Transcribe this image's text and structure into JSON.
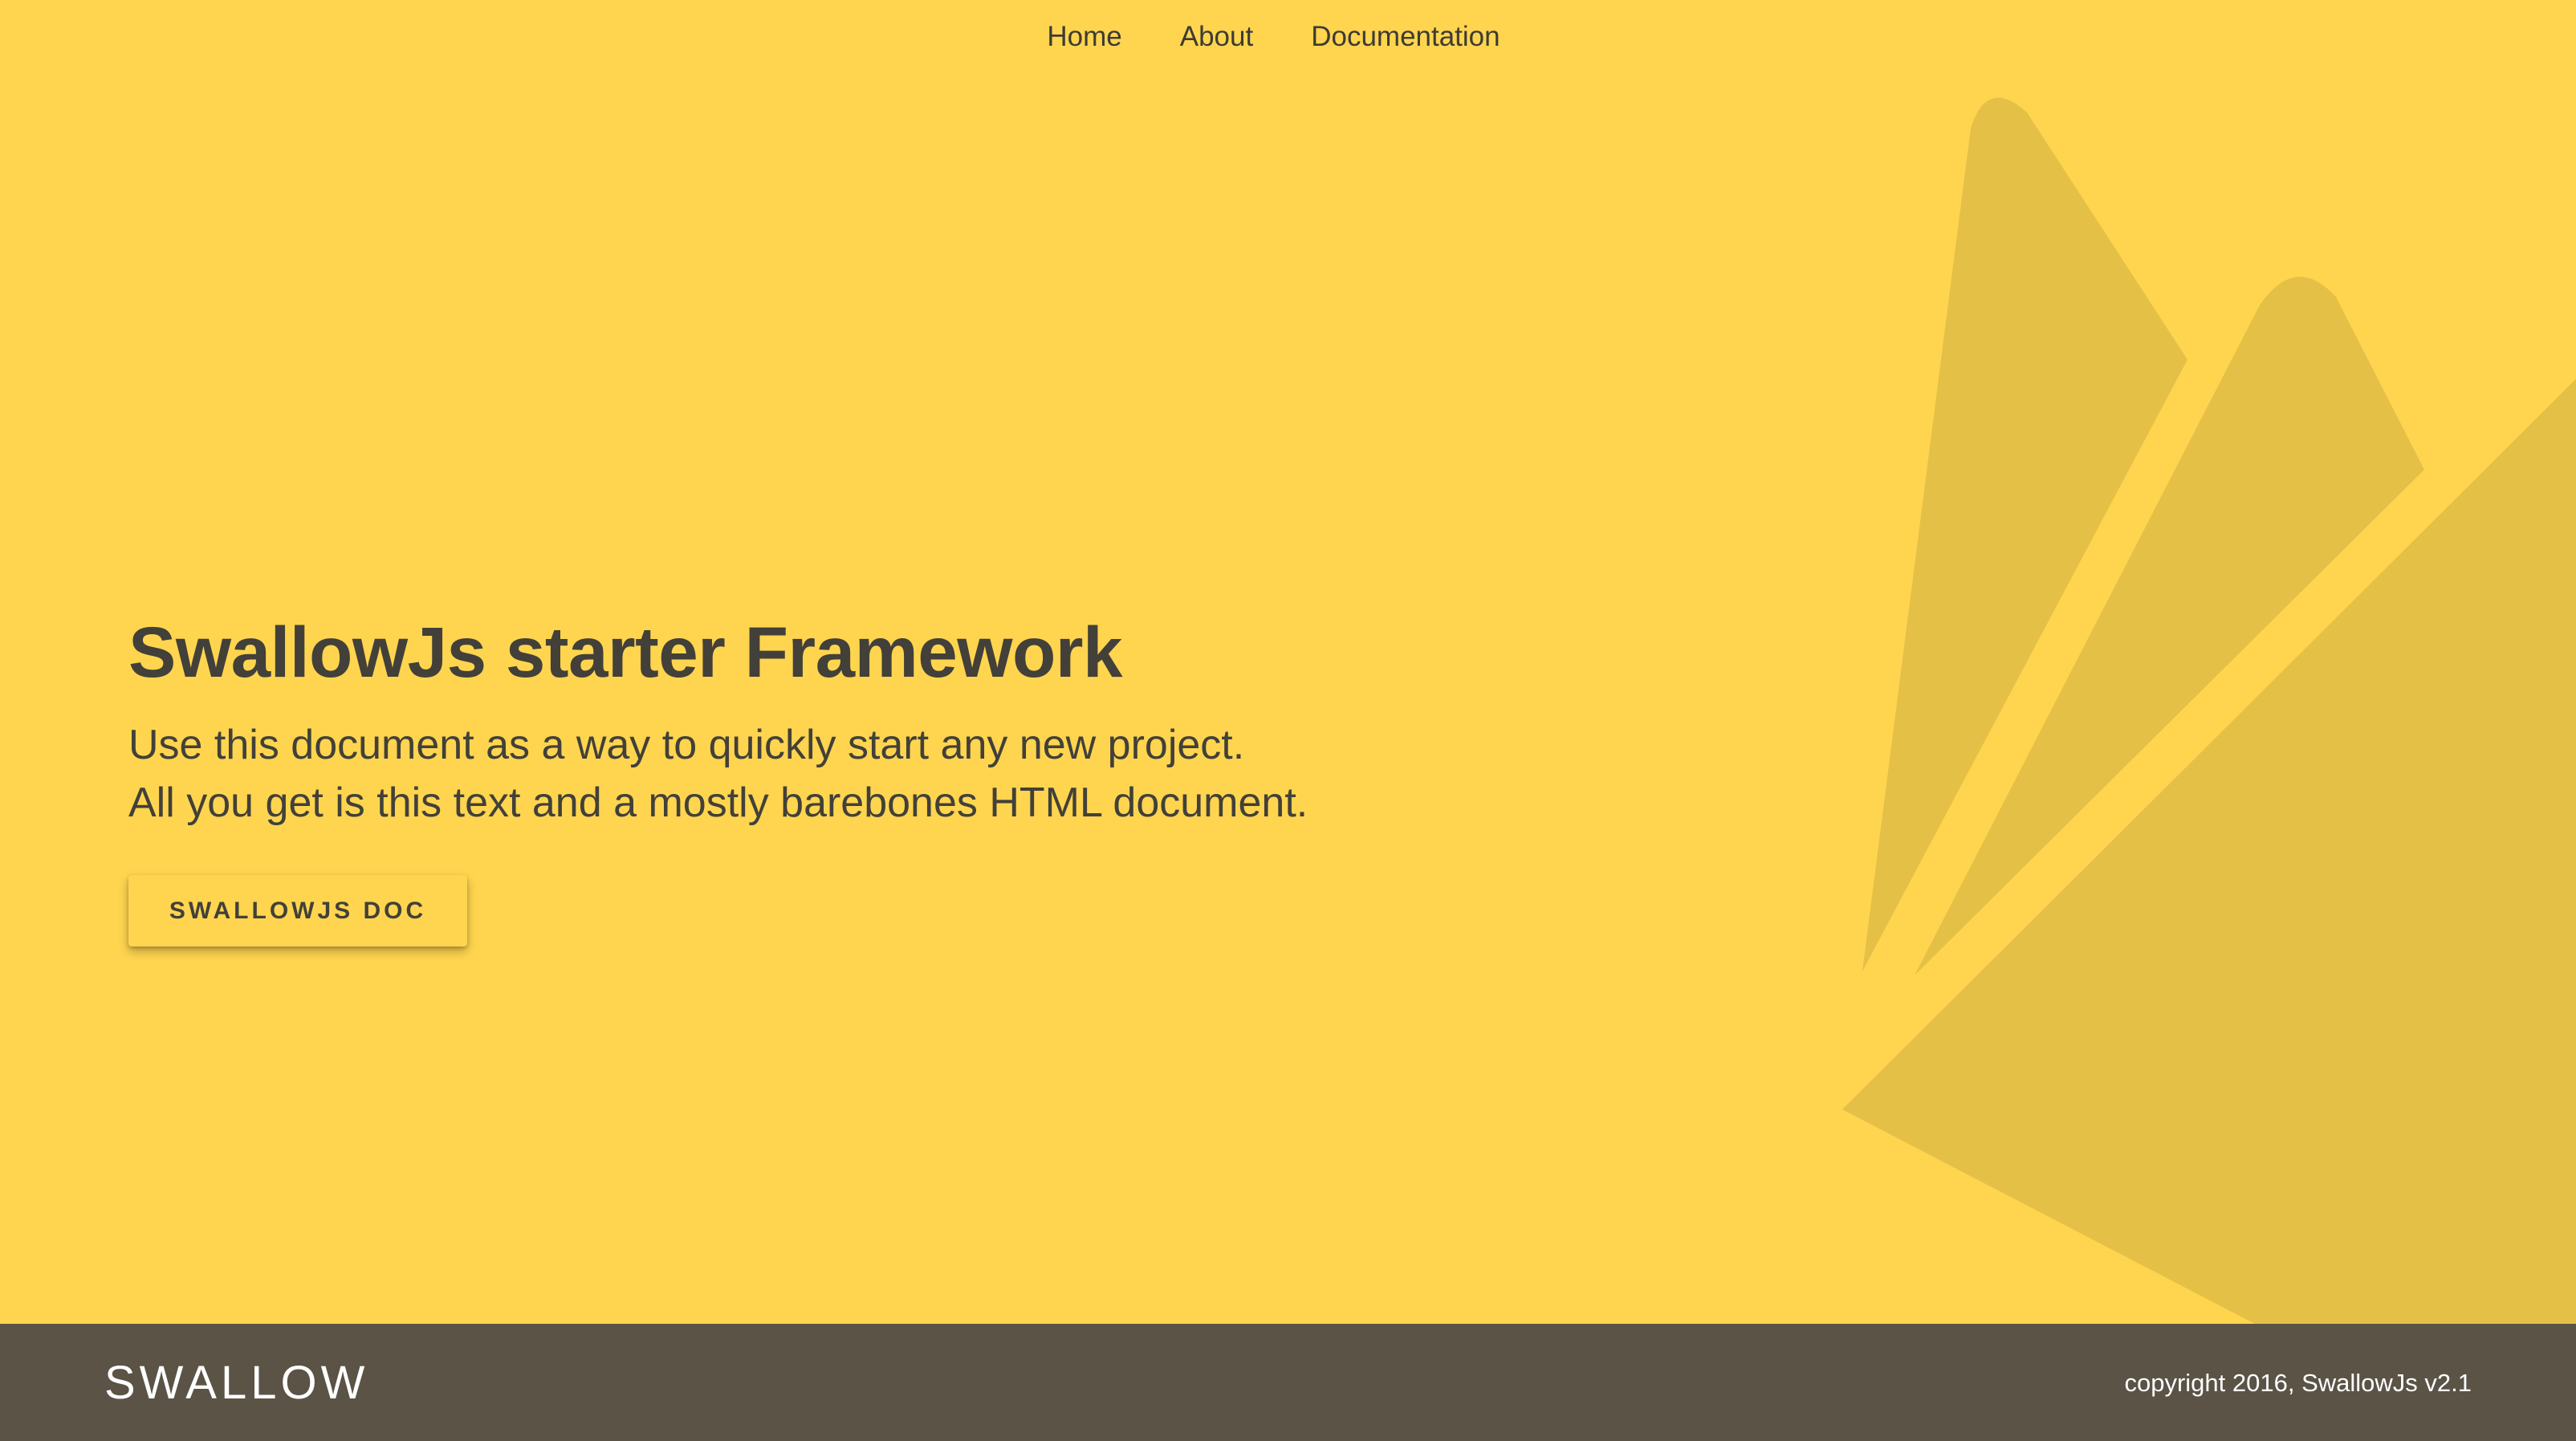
{
  "nav": {
    "items": [
      {
        "label": "Home"
      },
      {
        "label": "About"
      },
      {
        "label": "Documentation"
      }
    ]
  },
  "hero": {
    "title": "SwallowJs starter Framework",
    "lead_line1": "Use this document as a way to quickly start any new project.",
    "lead_line2": "All you get is this text and a mostly barebones HTML document.",
    "button_label": "SWALLOWJS DOC"
  },
  "footer": {
    "brand": "SWALLOW",
    "copyright": "copyright 2016, SwallowJs v2.1"
  },
  "colors": {
    "background": "#ffd54f",
    "footer": "#5a5346",
    "text": "#424039",
    "logo_shape": "#e5c046"
  },
  "icons": {
    "background_logo": "firebase-flame-icon"
  }
}
